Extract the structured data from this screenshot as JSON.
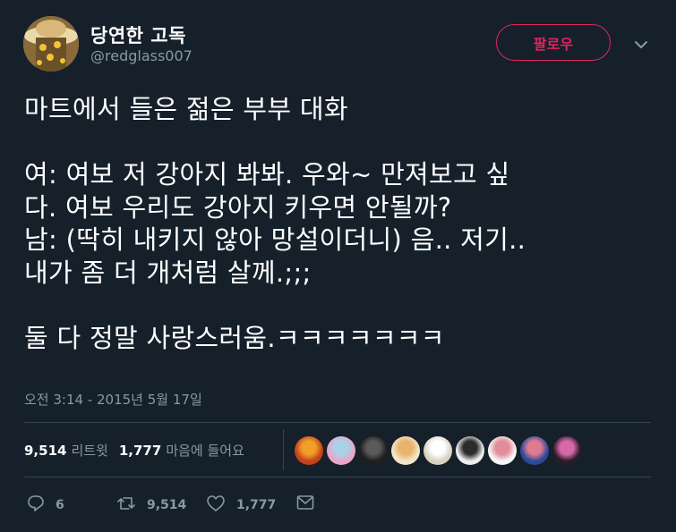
{
  "author": {
    "name": "당연한 고독",
    "handle": "@redglass007",
    "follow_label": "팔로우"
  },
  "tweet": {
    "lines": [
      "마트에서 들은 젊은 부부 대화",
      "",
      "여: 여보 저 강아지 봐봐. 우와~ 만져보고 싶",
      "다. 여보 우리도 강아지 키우면 안될까?",
      "남: (딱히 내키지 않아 망설이더니) 음.. 저기..",
      "내가 좀 더 개처럼 살께.;;;",
      "",
      "둘 다 정말 사랑스러움.ㅋㅋㅋㅋㅋㅋㅋ"
    ],
    "timestamp": "오전 3:14 - 2015년 5월 17일"
  },
  "stats": {
    "retweets_count": "9,514",
    "retweets_label": "리트윗",
    "likes_count": "1,777",
    "likes_label": "마음에 들어요"
  },
  "liker_avatars": [
    {
      "name": "liker-avatar-1",
      "color": "#c4421a",
      "accent": "#f0a02a"
    },
    {
      "name": "liker-avatar-2",
      "color": "#e9a6c8",
      "accent": "#a8d2e8"
    },
    {
      "name": "liker-avatar-3",
      "color": "#1f1f1f",
      "accent": "#5a5a5a"
    },
    {
      "name": "liker-avatar-4",
      "color": "#f3e6c8",
      "accent": "#e9b36e"
    },
    {
      "name": "liker-avatar-5",
      "color": "#d8d2c0",
      "accent": "#ffffff"
    },
    {
      "name": "liker-avatar-6",
      "color": "#eeeeee",
      "accent": "#2b2b2b"
    },
    {
      "name": "liker-avatar-7",
      "color": "#f6f6f6",
      "accent": "#e38c9a"
    },
    {
      "name": "liker-avatar-8",
      "color": "#2a4a9a",
      "accent": "#e07a8e"
    },
    {
      "name": "liker-avatar-9",
      "color": "#2a1a2a",
      "accent": "#d66aa8"
    }
  ],
  "actions": {
    "reply_count": "6",
    "retweet_count": "9,514",
    "like_count": "1,777"
  },
  "colors": {
    "background": "#15202b",
    "text_primary": "#ffffff",
    "text_secondary": "#8899a6",
    "accent": "#e0245e",
    "divider": "#38444d"
  }
}
